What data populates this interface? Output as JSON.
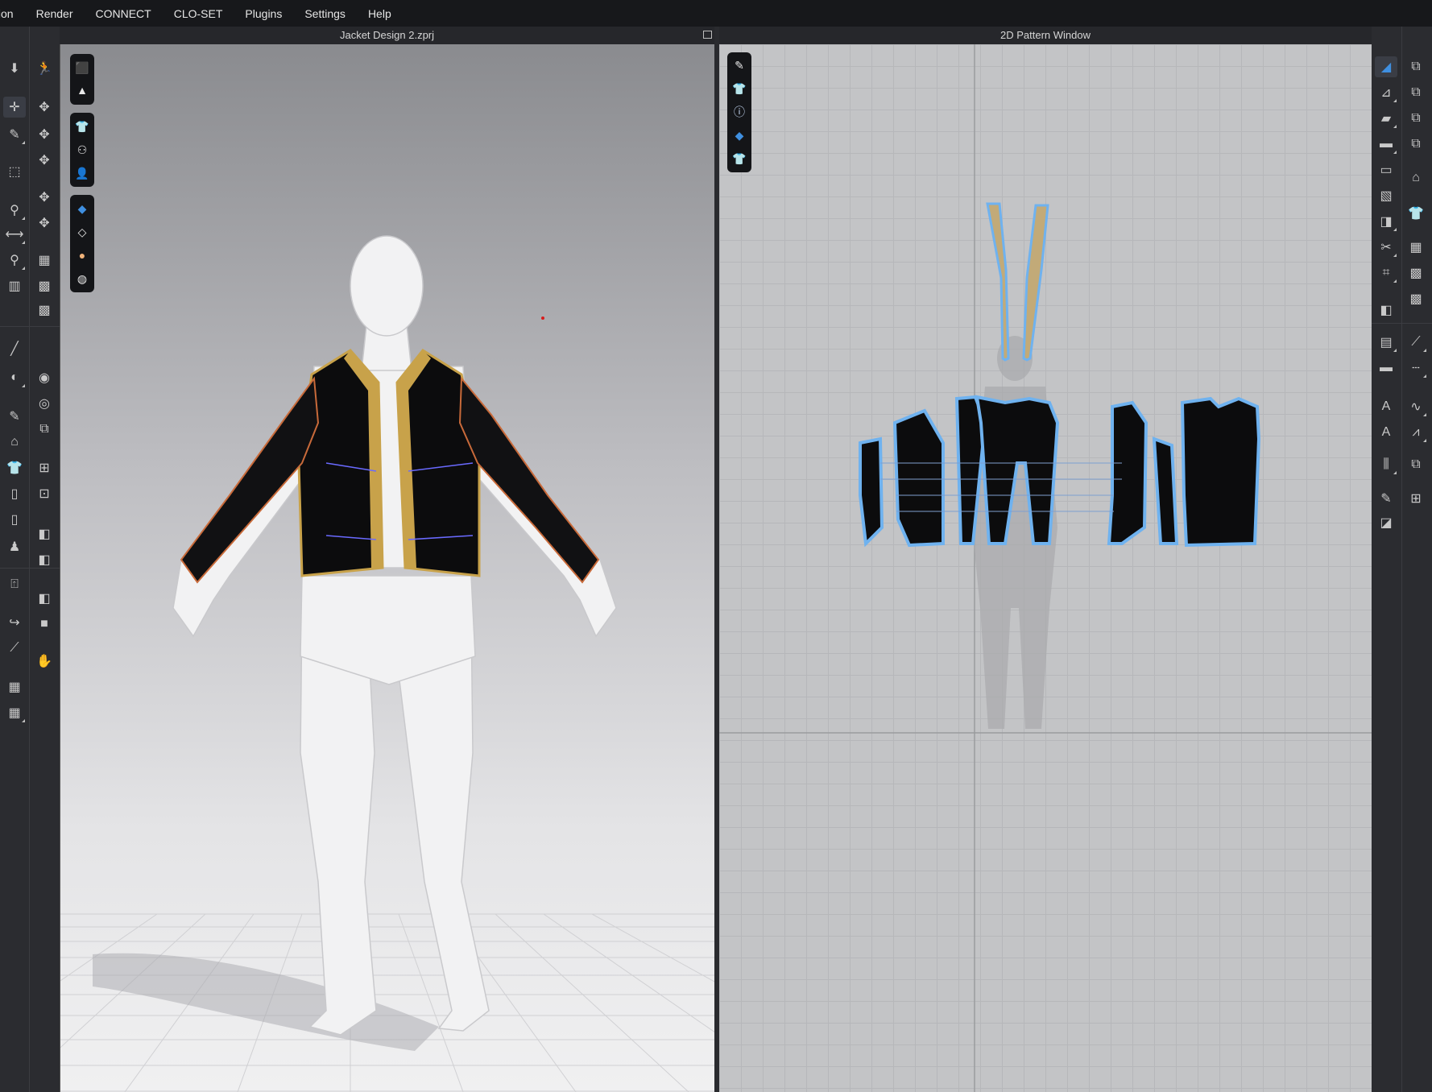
{
  "menubar": {
    "items": [
      "tion",
      "Render",
      "CONNECT",
      "CLO-SET",
      "Plugins",
      "Settings",
      "Help"
    ]
  },
  "viewport3d": {
    "title": "Jacket Design 2.zprj"
  },
  "pattern2d": {
    "title": "2D Pattern Window"
  },
  "colors": {
    "accent": "#3f8fe0",
    "jacket": "#0c0c0d",
    "trim": "#c8a24a",
    "pattern_outline": "#6fb2ef",
    "collar_piece": "#c2aa78"
  }
}
